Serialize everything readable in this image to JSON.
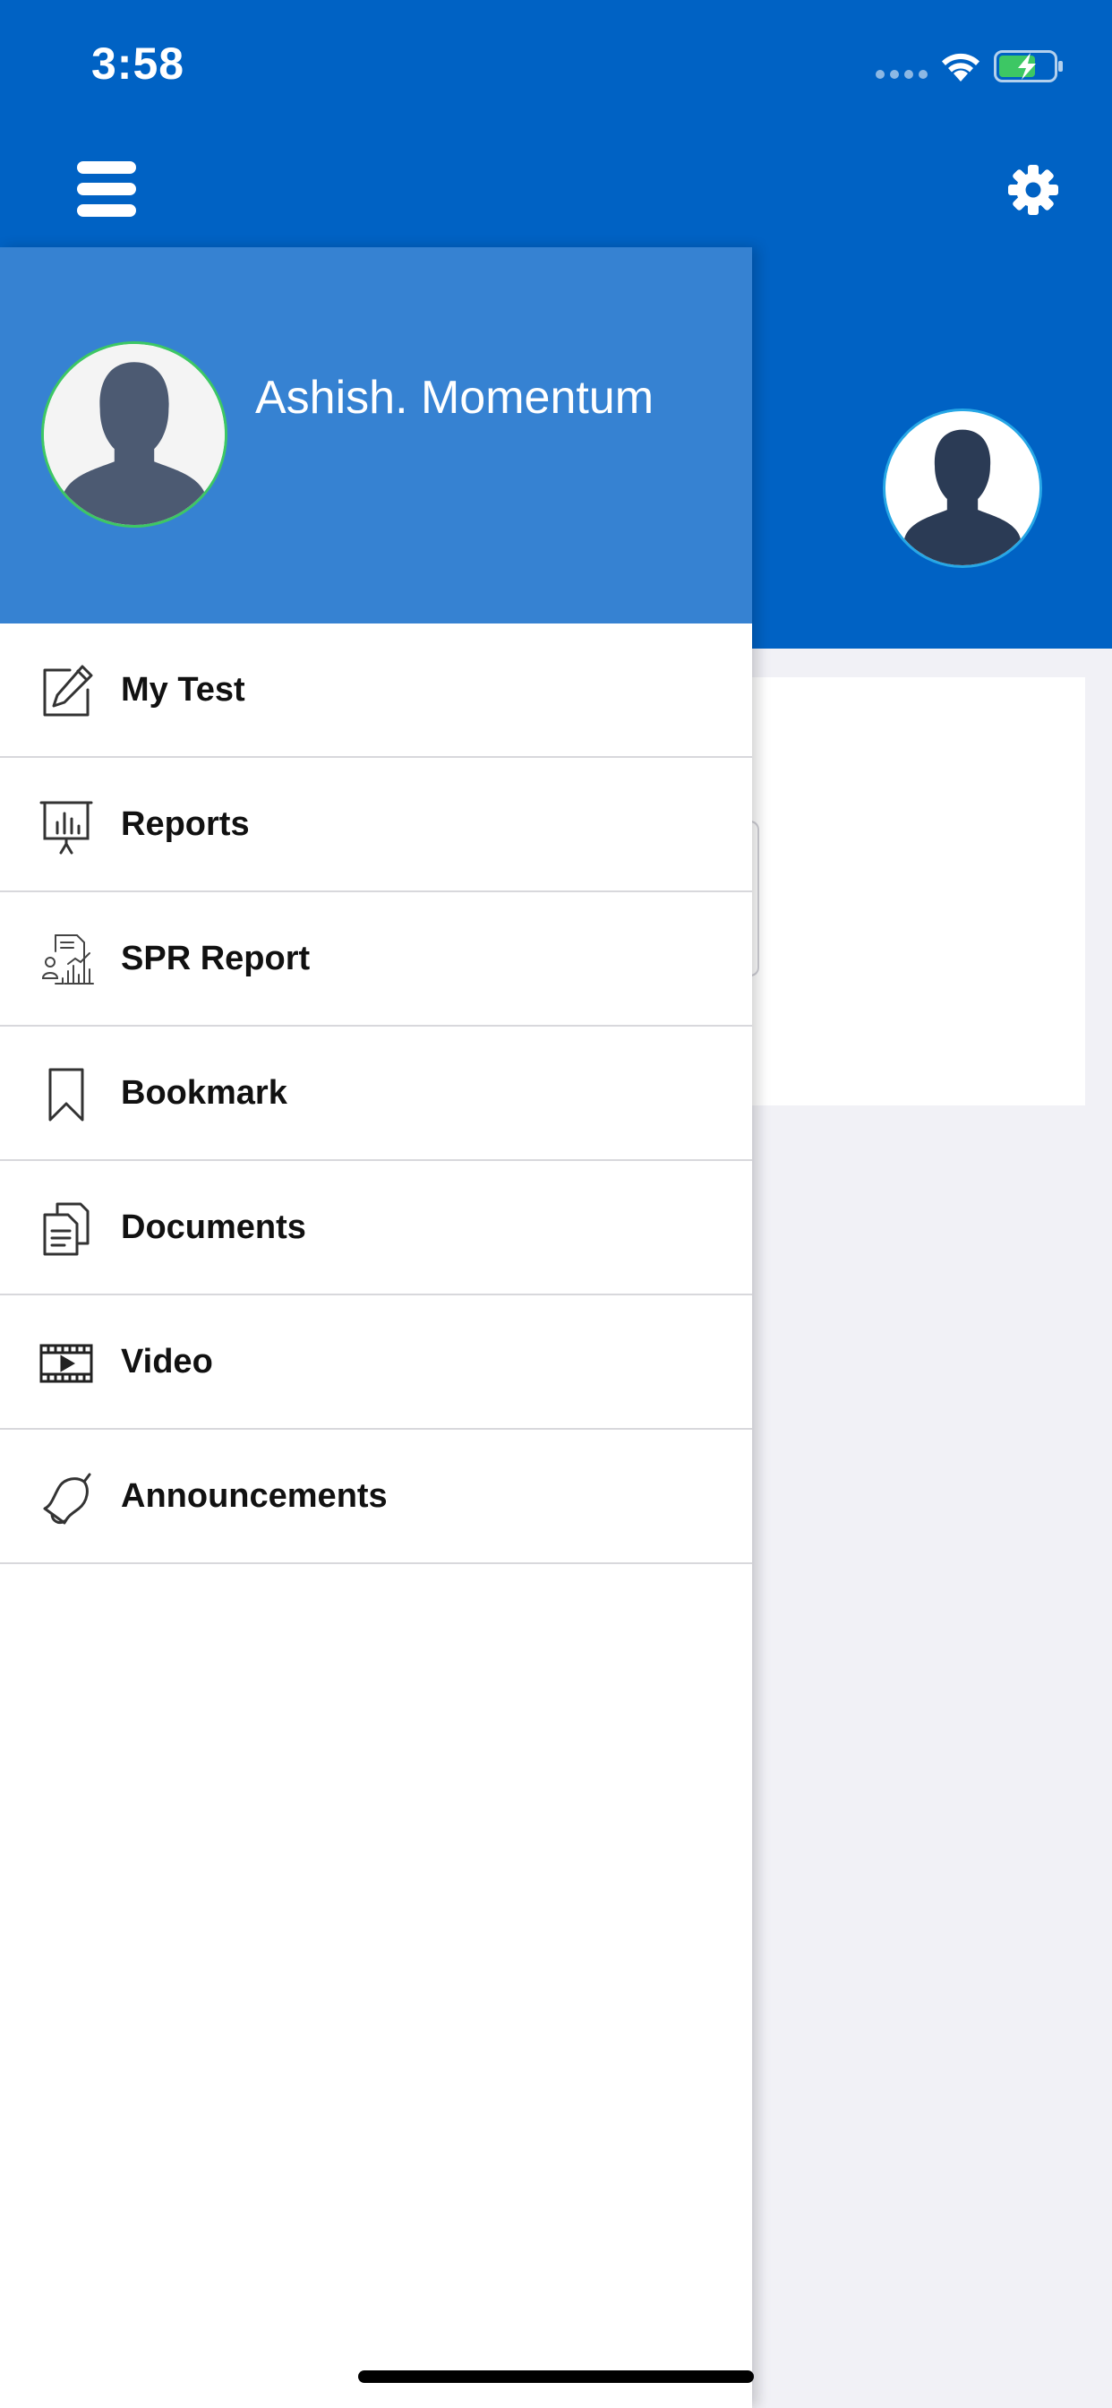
{
  "status_bar": {
    "time": "3:58"
  },
  "colors": {
    "primary": "#0062c4",
    "drawer_header": "#3682d2",
    "page_background": "#f1f1f6",
    "profile_ring": "#3dc764",
    "battery_charge": "#3dc764"
  },
  "nav": {
    "menu_icon": "hamburger-icon",
    "settings_icon": "gear-icon"
  },
  "drawer": {
    "profile": {
      "name": "Ashish. Momentum"
    },
    "menu": [
      {
        "label": "My Test",
        "icon": "edit-icon"
      },
      {
        "label": "Reports",
        "icon": "presentation-chart-icon"
      },
      {
        "label": "SPR Report",
        "icon": "report-analytics-icon"
      },
      {
        "label": "Bookmark",
        "icon": "bookmark-icon"
      },
      {
        "label": "Documents",
        "icon": "documents-icon"
      },
      {
        "label": "Video",
        "icon": "video-icon"
      },
      {
        "label": "Announcements",
        "icon": "bell-icon"
      }
    ]
  }
}
